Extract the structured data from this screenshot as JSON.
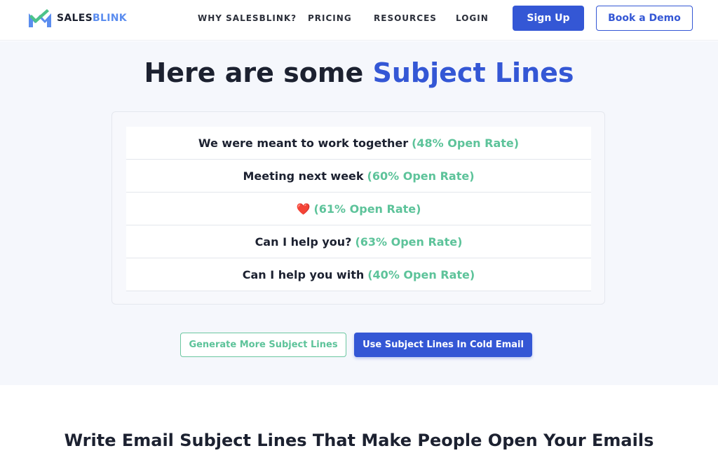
{
  "brand": {
    "name_part1": "SALES",
    "name_part2": "BLINK",
    "colors": {
      "primary": "#3457d5",
      "green": "#5dc39a",
      "logo_blue": "#5b8def"
    }
  },
  "nav": {
    "items": [
      {
        "label": "WHY SALESBLINK?"
      },
      {
        "label": "PRICING"
      },
      {
        "label": "RESOURCES"
      },
      {
        "label": "LOGIN"
      }
    ],
    "signup_label": "Sign Up",
    "demo_label": "Book a Demo"
  },
  "hero": {
    "title_part1": "Here are some ",
    "title_part2": "Subject Lines",
    "subject_lines": [
      {
        "text": "We were meant to work together",
        "rate": "(48% Open Rate)"
      },
      {
        "text": "Meeting next week",
        "rate": "(60% Open Rate)"
      },
      {
        "text": "❤️",
        "rate": "(61% Open Rate)"
      },
      {
        "text": "Can I help you?",
        "rate": "(63% Open Rate)"
      },
      {
        "text": "Can I help you with",
        "rate": "(40% Open Rate)"
      }
    ],
    "generate_label": "Generate More Subject Lines",
    "use_label": "Use Subject Lines In Cold Email"
  },
  "section": {
    "title": "Write Email Subject Lines That Make People Open Your Emails"
  }
}
